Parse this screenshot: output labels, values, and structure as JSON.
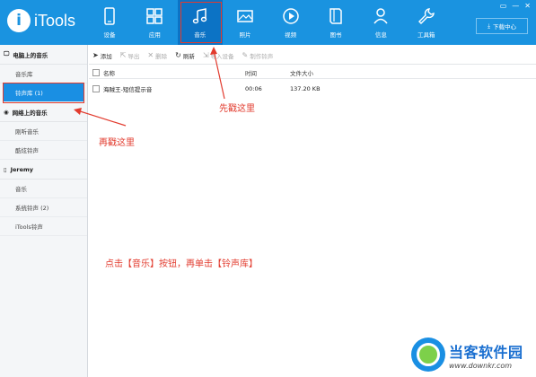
{
  "app": {
    "logo_letter": "i",
    "logo_text": "iTools"
  },
  "nav": [
    {
      "label": "设备",
      "icon": "phone-icon"
    },
    {
      "label": "应用",
      "icon": "apps-icon"
    },
    {
      "label": "音乐",
      "icon": "music-note-icon",
      "active": true
    },
    {
      "label": "照片",
      "icon": "photo-icon"
    },
    {
      "label": "视频",
      "icon": "play-icon"
    },
    {
      "label": "图书",
      "icon": "book-icon"
    },
    {
      "label": "信息",
      "icon": "person-icon"
    },
    {
      "label": "工具箱",
      "icon": "wrench-icon"
    }
  ],
  "header": {
    "download_label": "下载中心",
    "window_controls": [
      "▭",
      "—",
      "✕"
    ]
  },
  "sidebar": {
    "sections": [
      {
        "title": "电脑上的音乐",
        "icon": "monitor-icon",
        "items": [
          {
            "label": "音乐库"
          },
          {
            "label": "铃声库 (1)",
            "selected": true
          }
        ]
      },
      {
        "title": "网络上的音乐",
        "icon": "globe-icon",
        "items": [
          {
            "label": "刚听音乐"
          },
          {
            "label": "酷炫铃声"
          }
        ]
      },
      {
        "title": "Jeremy",
        "icon": "device-icon",
        "items": [
          {
            "label": "音乐"
          },
          {
            "label": "系统铃声 (2)"
          },
          {
            "label": "iTools铃声"
          }
        ]
      }
    ]
  },
  "toolbar": {
    "buttons": [
      {
        "label": "添加",
        "icon": "add-arrow-icon",
        "enabled": true
      },
      {
        "label": "导出",
        "icon": "export-icon",
        "enabled": false
      },
      {
        "label": "删除",
        "icon": "delete-icon",
        "enabled": false
      },
      {
        "label": "刷新",
        "icon": "refresh-icon",
        "enabled": true
      },
      {
        "label": "导入设备",
        "icon": "import-icon",
        "enabled": false
      },
      {
        "label": "制作铃声",
        "icon": "wand-icon",
        "enabled": false
      }
    ]
  },
  "table": {
    "headers": {
      "name": "名称",
      "time": "时间",
      "size": "文件大小"
    },
    "rows": [
      {
        "name": "海贼王-短信提示音",
        "time": "00:06",
        "size": "137.20 KB"
      }
    ]
  },
  "annotations": {
    "first": "先戳这里",
    "second": "再戳这里",
    "instruction": "点击【音乐】按钮，再单击【铃声库】"
  },
  "watermark": {
    "cn": "当客软件园",
    "url": "www.downkr.com"
  },
  "colors": {
    "topbar": "#1a93e0",
    "active_nav": "#0c73c5",
    "annotation": "#e23b2e",
    "selected_item": "#1a8fe3"
  }
}
